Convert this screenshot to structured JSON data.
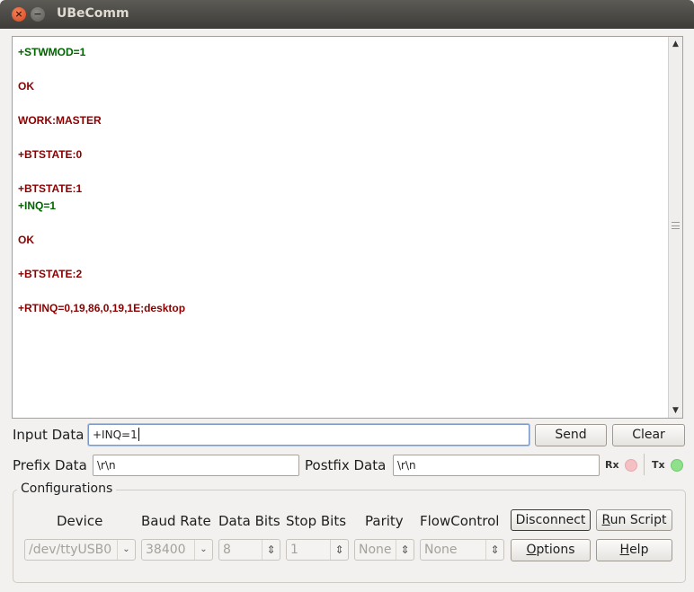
{
  "window": {
    "title": "UBeComm",
    "close_glyph": "×",
    "min_glyph": "−"
  },
  "output_lines": [
    {
      "text": "+STWMOD=1",
      "color": "green"
    },
    {
      "text": "",
      "color": "red"
    },
    {
      "text": "OK",
      "color": "red"
    },
    {
      "text": "",
      "color": "red"
    },
    {
      "text": "WORK:MASTER",
      "color": "red"
    },
    {
      "text": "",
      "color": "red"
    },
    {
      "text": "+BTSTATE:0",
      "color": "red"
    },
    {
      "text": "",
      "color": "red"
    },
    {
      "text": "+BTSTATE:1",
      "color": "red"
    },
    {
      "text": "+INQ=1",
      "color": "green"
    },
    {
      "text": "",
      "color": "red"
    },
    {
      "text": "OK",
      "color": "red"
    },
    {
      "text": "",
      "color": "red"
    },
    {
      "text": "+BTSTATE:2",
      "color": "red"
    },
    {
      "text": "",
      "color": "red"
    },
    {
      "text": "+RTINQ=0,19,86,0,19,1E;desktop",
      "color": "red"
    }
  ],
  "colors": {
    "green": "#006400",
    "red": "#8b0000",
    "rx_led": "#f5c0c4",
    "tx_led": "#8ee08a"
  },
  "input": {
    "label": "Input Data",
    "value": "+INQ=1",
    "send": "Send",
    "clear": "Clear"
  },
  "prefix": {
    "label": "Prefix Data",
    "value": "\\r\\n"
  },
  "postfix": {
    "label": "Postfix Data",
    "value": "\\r\\n"
  },
  "indicators": {
    "rx": "Rx",
    "tx": "Tx"
  },
  "config": {
    "title": "Configurations",
    "device": {
      "label": "Device",
      "value": "/dev/ttyUSB0"
    },
    "baud": {
      "label": "Baud Rate",
      "value": "38400"
    },
    "data_bits": {
      "label": "Data Bits",
      "value": "8"
    },
    "stop_bits": {
      "label": "Stop Bits",
      "value": "1"
    },
    "parity": {
      "label": "Parity",
      "value": "None"
    },
    "flow": {
      "label": "FlowControl",
      "value": "None"
    },
    "disconnect": "Disconnect",
    "run_script": "Run Script",
    "options": "Options",
    "help": "Help"
  },
  "icons": {
    "combo_arrow": "⌄",
    "spin_arrows": "⇕",
    "scroll_up": "▲",
    "scroll_down": "▼"
  }
}
